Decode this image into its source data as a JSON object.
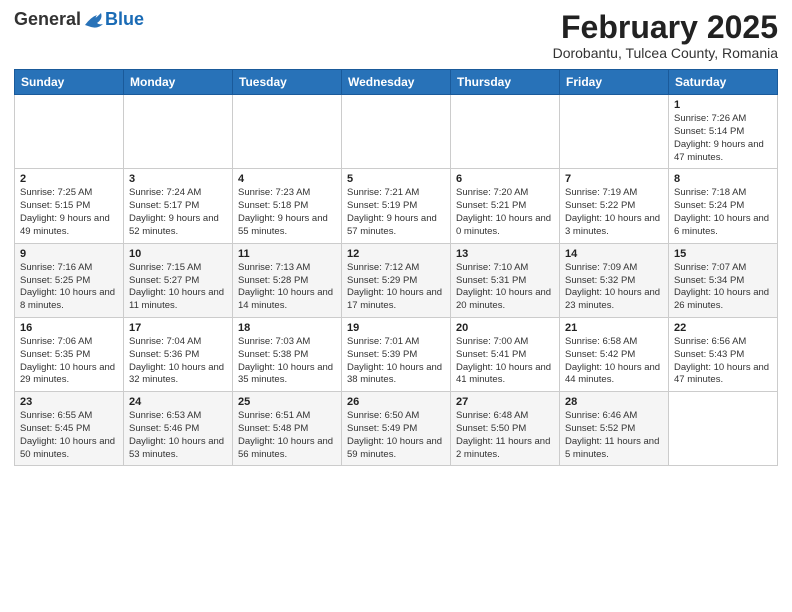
{
  "header": {
    "logo": {
      "general": "General",
      "blue": "Blue"
    },
    "title": "February 2025",
    "subtitle": "Dorobantu, Tulcea County, Romania"
  },
  "weekdays": [
    "Sunday",
    "Monday",
    "Tuesday",
    "Wednesday",
    "Thursday",
    "Friday",
    "Saturday"
  ],
  "weeks": [
    [
      {
        "day": "",
        "info": ""
      },
      {
        "day": "",
        "info": ""
      },
      {
        "day": "",
        "info": ""
      },
      {
        "day": "",
        "info": ""
      },
      {
        "day": "",
        "info": ""
      },
      {
        "day": "",
        "info": ""
      },
      {
        "day": "1",
        "info": "Sunrise: 7:26 AM\nSunset: 5:14 PM\nDaylight: 9 hours and 47 minutes."
      }
    ],
    [
      {
        "day": "2",
        "info": "Sunrise: 7:25 AM\nSunset: 5:15 PM\nDaylight: 9 hours and 49 minutes."
      },
      {
        "day": "3",
        "info": "Sunrise: 7:24 AM\nSunset: 5:17 PM\nDaylight: 9 hours and 52 minutes."
      },
      {
        "day": "4",
        "info": "Sunrise: 7:23 AM\nSunset: 5:18 PM\nDaylight: 9 hours and 55 minutes."
      },
      {
        "day": "5",
        "info": "Sunrise: 7:21 AM\nSunset: 5:19 PM\nDaylight: 9 hours and 57 minutes."
      },
      {
        "day": "6",
        "info": "Sunrise: 7:20 AM\nSunset: 5:21 PM\nDaylight: 10 hours and 0 minutes."
      },
      {
        "day": "7",
        "info": "Sunrise: 7:19 AM\nSunset: 5:22 PM\nDaylight: 10 hours and 3 minutes."
      },
      {
        "day": "8",
        "info": "Sunrise: 7:18 AM\nSunset: 5:24 PM\nDaylight: 10 hours and 6 minutes."
      }
    ],
    [
      {
        "day": "9",
        "info": "Sunrise: 7:16 AM\nSunset: 5:25 PM\nDaylight: 10 hours and 8 minutes."
      },
      {
        "day": "10",
        "info": "Sunrise: 7:15 AM\nSunset: 5:27 PM\nDaylight: 10 hours and 11 minutes."
      },
      {
        "day": "11",
        "info": "Sunrise: 7:13 AM\nSunset: 5:28 PM\nDaylight: 10 hours and 14 minutes."
      },
      {
        "day": "12",
        "info": "Sunrise: 7:12 AM\nSunset: 5:29 PM\nDaylight: 10 hours and 17 minutes."
      },
      {
        "day": "13",
        "info": "Sunrise: 7:10 AM\nSunset: 5:31 PM\nDaylight: 10 hours and 20 minutes."
      },
      {
        "day": "14",
        "info": "Sunrise: 7:09 AM\nSunset: 5:32 PM\nDaylight: 10 hours and 23 minutes."
      },
      {
        "day": "15",
        "info": "Sunrise: 7:07 AM\nSunset: 5:34 PM\nDaylight: 10 hours and 26 minutes."
      }
    ],
    [
      {
        "day": "16",
        "info": "Sunrise: 7:06 AM\nSunset: 5:35 PM\nDaylight: 10 hours and 29 minutes."
      },
      {
        "day": "17",
        "info": "Sunrise: 7:04 AM\nSunset: 5:36 PM\nDaylight: 10 hours and 32 minutes."
      },
      {
        "day": "18",
        "info": "Sunrise: 7:03 AM\nSunset: 5:38 PM\nDaylight: 10 hours and 35 minutes."
      },
      {
        "day": "19",
        "info": "Sunrise: 7:01 AM\nSunset: 5:39 PM\nDaylight: 10 hours and 38 minutes."
      },
      {
        "day": "20",
        "info": "Sunrise: 7:00 AM\nSunset: 5:41 PM\nDaylight: 10 hours and 41 minutes."
      },
      {
        "day": "21",
        "info": "Sunrise: 6:58 AM\nSunset: 5:42 PM\nDaylight: 10 hours and 44 minutes."
      },
      {
        "day": "22",
        "info": "Sunrise: 6:56 AM\nSunset: 5:43 PM\nDaylight: 10 hours and 47 minutes."
      }
    ],
    [
      {
        "day": "23",
        "info": "Sunrise: 6:55 AM\nSunset: 5:45 PM\nDaylight: 10 hours and 50 minutes."
      },
      {
        "day": "24",
        "info": "Sunrise: 6:53 AM\nSunset: 5:46 PM\nDaylight: 10 hours and 53 minutes."
      },
      {
        "day": "25",
        "info": "Sunrise: 6:51 AM\nSunset: 5:48 PM\nDaylight: 10 hours and 56 minutes."
      },
      {
        "day": "26",
        "info": "Sunrise: 6:50 AM\nSunset: 5:49 PM\nDaylight: 10 hours and 59 minutes."
      },
      {
        "day": "27",
        "info": "Sunrise: 6:48 AM\nSunset: 5:50 PM\nDaylight: 11 hours and 2 minutes."
      },
      {
        "day": "28",
        "info": "Sunrise: 6:46 AM\nSunset: 5:52 PM\nDaylight: 11 hours and 5 minutes."
      },
      {
        "day": "",
        "info": ""
      }
    ]
  ]
}
